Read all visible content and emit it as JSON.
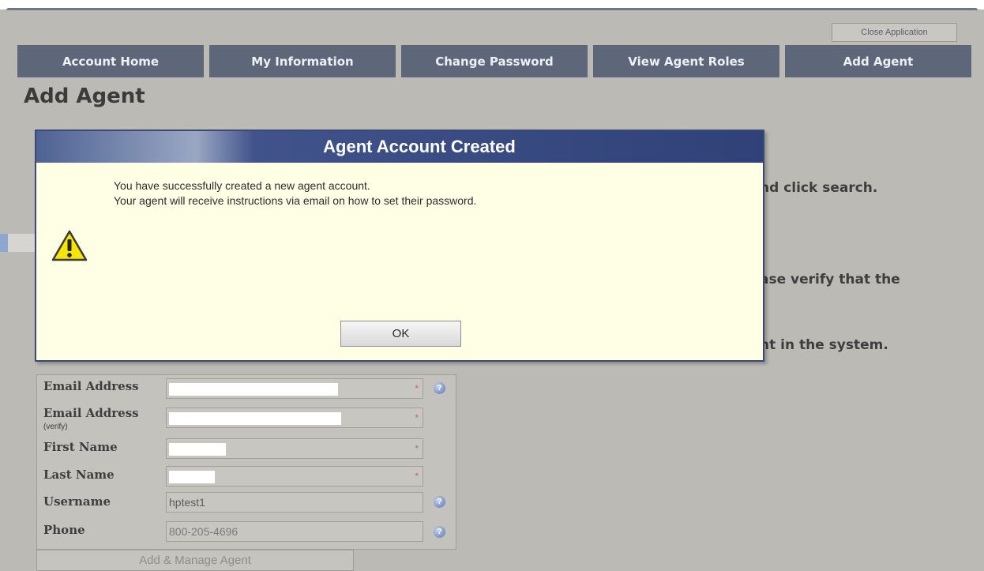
{
  "header": {
    "close_label": "Close Application"
  },
  "nav": {
    "tabs": [
      {
        "label": "Account Home"
      },
      {
        "label": "My Information"
      },
      {
        "label": "Change Password"
      },
      {
        "label": "View Agent Roles"
      },
      {
        "label": "Add Agent"
      }
    ]
  },
  "page": {
    "title": "Add Agent",
    "background_fragments": [
      "nd click search.",
      "ase verify that the",
      "nt in the system."
    ]
  },
  "form": {
    "fields": [
      {
        "label": "Email Address",
        "sublabel": "",
        "value": "",
        "required": true
      },
      {
        "label": "Email Address",
        "sublabel": "(verify)",
        "value": "",
        "required": true
      },
      {
        "label": "First Name",
        "sublabel": "",
        "value": "",
        "required": true
      },
      {
        "label": "Last Name",
        "sublabel": "",
        "value": "",
        "required": true
      },
      {
        "label": "Username",
        "sublabel": "",
        "value": "hptest1",
        "required": false
      },
      {
        "label": "Phone",
        "sublabel": "",
        "value": "800-205-4696",
        "required": false
      }
    ],
    "required_marker": "*",
    "help_glyph": "?",
    "submit_label": "Add & Manage Agent"
  },
  "dialog": {
    "title": "Agent Account Created",
    "message_line1": "You have successfully created a new agent account.",
    "message_line2": "Your agent will receive instructions via email on how to set their password.",
    "icon": "warning-icon",
    "ok_label": "OK"
  },
  "colors": {
    "nav_tab_bg": "#5e6779",
    "dialog_bg": "#ffffe6",
    "dialog_title_bg": "#2f4277",
    "page_bg": "#bcbab5"
  }
}
